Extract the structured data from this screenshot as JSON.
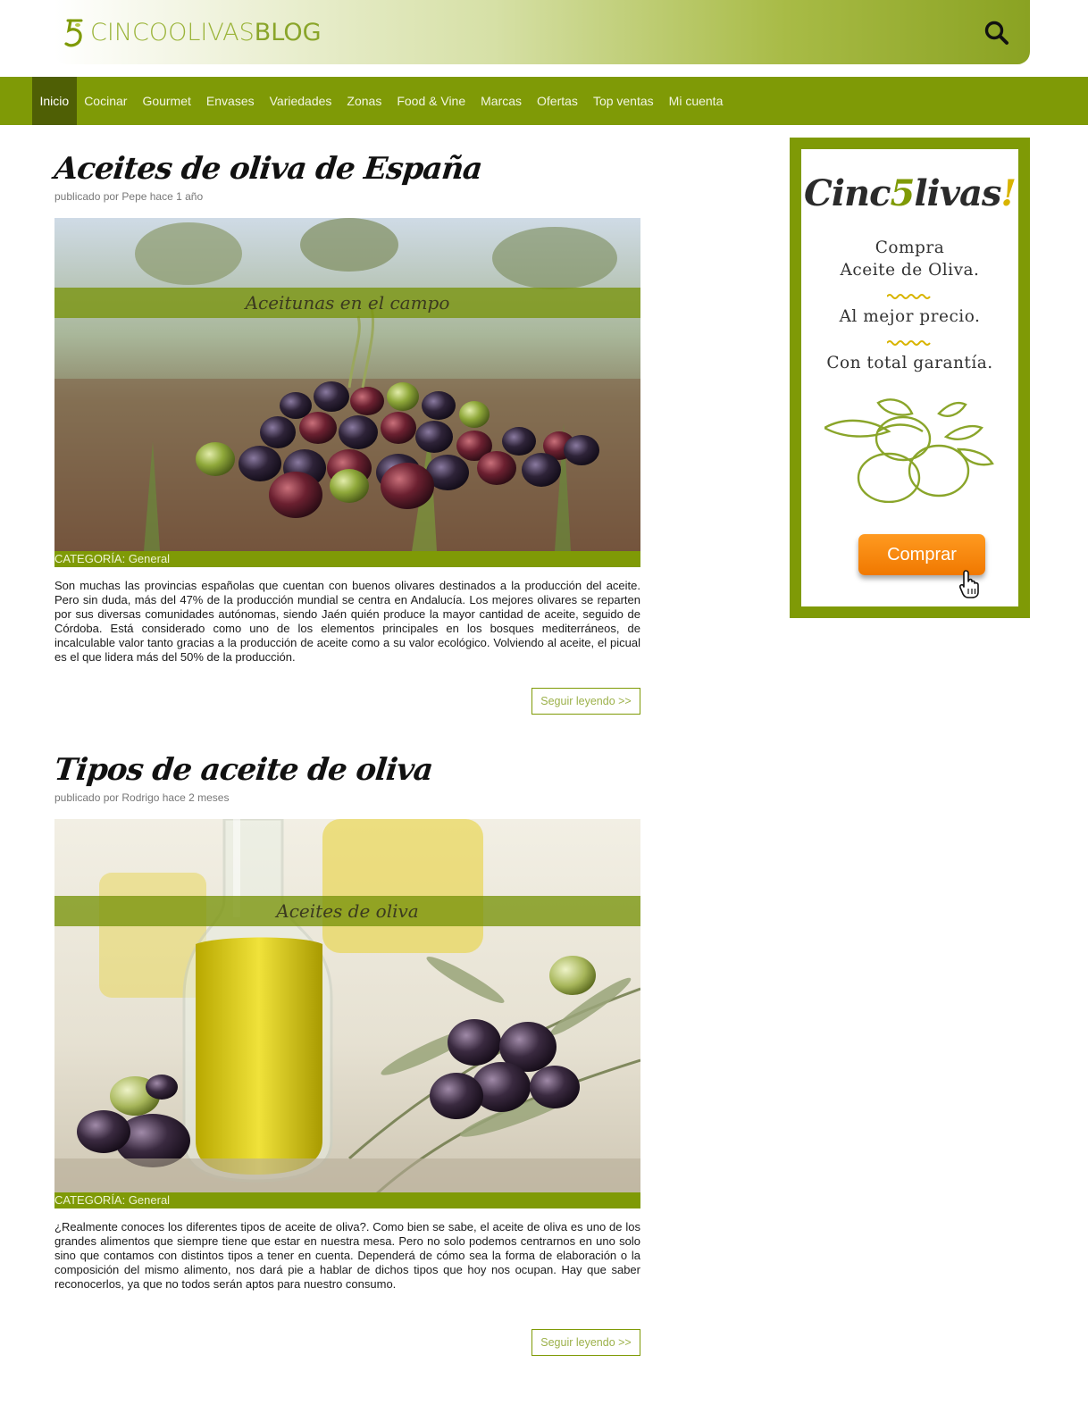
{
  "header": {
    "logo_part1": "CINCOOLIVAS",
    "logo_part2": "BLOG",
    "search_icon": "search-icon"
  },
  "nav": {
    "items": [
      {
        "label": "Inicio",
        "active": true
      },
      {
        "label": "Cocinar"
      },
      {
        "label": "Gourmet"
      },
      {
        "label": "Envases"
      },
      {
        "label": "Variedades"
      },
      {
        "label": "Zonas"
      },
      {
        "label": "Food & Vine"
      },
      {
        "label": "Marcas"
      },
      {
        "label": "Ofertas"
      },
      {
        "label": "Top ventas"
      },
      {
        "label": "Mi cuenta"
      }
    ]
  },
  "posts": [
    {
      "title": "Aceites de oliva de España",
      "meta": "publicado por Pepe hace 1 año",
      "image_caption": "Aceitunas en el campo",
      "category": "CATEGORÍA: General",
      "excerpt": "Son muchas las provincias españolas que cuentan con buenos olivares destinados a la producción del aceite. Pero sin duda, más del 47% de la producción mundial se centra en Andalucía. Los mejores olivares se reparten por sus diversas comunidades autónomas, siendo Jaén quién produce la mayor cantidad de aceite, seguido de Córdoba. Está considerado como uno de los elementos principales en los bosques mediterráneos, de incalculable valor tanto gracias a la producción de aceite como a su valor ecológico. Volviendo al aceite, el picual es el que lidera más del 50% de la producción.",
      "read_more": "Seguir leyendo >>"
    },
    {
      "title": "Tipos de aceite de oliva",
      "meta": "publicado por Rodrigo hace 2 meses",
      "image_caption": "Aceites de oliva",
      "category": "CATEGORÍA: General",
      "excerpt": "¿Realmente conoces los diferentes tipos de aceite de oliva?. Como bien se sabe, el aceite de oliva es uno de los grandes alimentos que siempre tiene que estar en nuestra mesa. Pero no solo podemos centrarnos en uno solo sino que contamos con distintos tipos a tener en cuenta. Dependerá de cómo sea la forma de elaboración o la composición del mismo alimento, nos dará pie a hablar de dichos tipos que hoy nos ocupan. Hay que saber reconocerlos, ya que no todos serán aptos para nuestro consumo.",
      "read_more": "Seguir leyendo >>"
    }
  ],
  "ad": {
    "brand_a": "Cinc",
    "brand_b": "livas",
    "brand_ex": "!",
    "line1": "Compra",
    "line2": "Aceite de Oliva.",
    "line3": "Al mejor precio.",
    "line4": "Con total garantía.",
    "button": "Comprar",
    "olives_icon": "olives-illustration-icon",
    "cursor_icon": "hand-cursor-icon"
  },
  "colors": {
    "brand_green": "#7f9a06",
    "nav_active": "#4f5f05",
    "button_orange": "#f58200"
  }
}
